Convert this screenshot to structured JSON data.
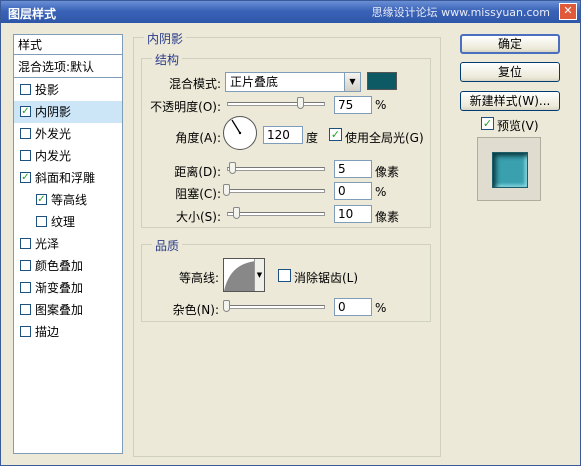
{
  "window": {
    "title": "图层样式",
    "watermark": "思缘设计论坛 www.missyuan.com",
    "close_glyph": "✕"
  },
  "style_list": {
    "header": "样式",
    "blend_options": "混合选项:默认",
    "items": [
      {
        "label": "投影",
        "checked": false
      },
      {
        "label": "内阴影",
        "checked": true,
        "selected": true
      },
      {
        "label": "外发光",
        "checked": false
      },
      {
        "label": "内发光",
        "checked": false
      },
      {
        "label": "斜面和浮雕",
        "checked": true
      },
      {
        "label": "等高线",
        "checked": true,
        "indent": true
      },
      {
        "label": "纹理",
        "checked": false,
        "indent": true
      },
      {
        "label": "光泽",
        "checked": false
      },
      {
        "label": "颜色叠加",
        "checked": false
      },
      {
        "label": "渐变叠加",
        "checked": false
      },
      {
        "label": "图案叠加",
        "checked": false
      },
      {
        "label": "描边",
        "checked": false
      }
    ]
  },
  "panel": {
    "title": "内阴影",
    "structure": {
      "legend": "结构",
      "blend_mode_label": "混合模式:",
      "blend_mode_value": "正片叠底",
      "blend_color": "#0e5a64",
      "opacity_label": "不透明度(O):",
      "opacity_value": "75",
      "opacity_unit": "%",
      "angle_label": "角度(A):",
      "angle_value": "120",
      "angle_unit": "度",
      "global_light_label": "使用全局光(G)",
      "global_light_checked": true,
      "distance_label": "距离(D):",
      "distance_value": "5",
      "distance_unit": "像素",
      "choke_label": "阻塞(C):",
      "choke_value": "0",
      "choke_unit": "%",
      "size_label": "大小(S):",
      "size_value": "10",
      "size_unit": "像素"
    },
    "quality": {
      "legend": "品质",
      "contour_label": "等高线:",
      "antialias_label": "消除锯齿(L)",
      "antialias_checked": false,
      "noise_label": "杂色(N):",
      "noise_value": "0",
      "noise_unit": "%"
    }
  },
  "buttons": {
    "ok": "确定",
    "reset": "复位",
    "new_style": "新建样式(W)...",
    "preview_label": "预览(V)",
    "preview_checked": true
  },
  "colors": {
    "titlebar": "#2f57a8",
    "selected_item": "#cde6f7",
    "preview_teal": "#3aa0ad"
  }
}
